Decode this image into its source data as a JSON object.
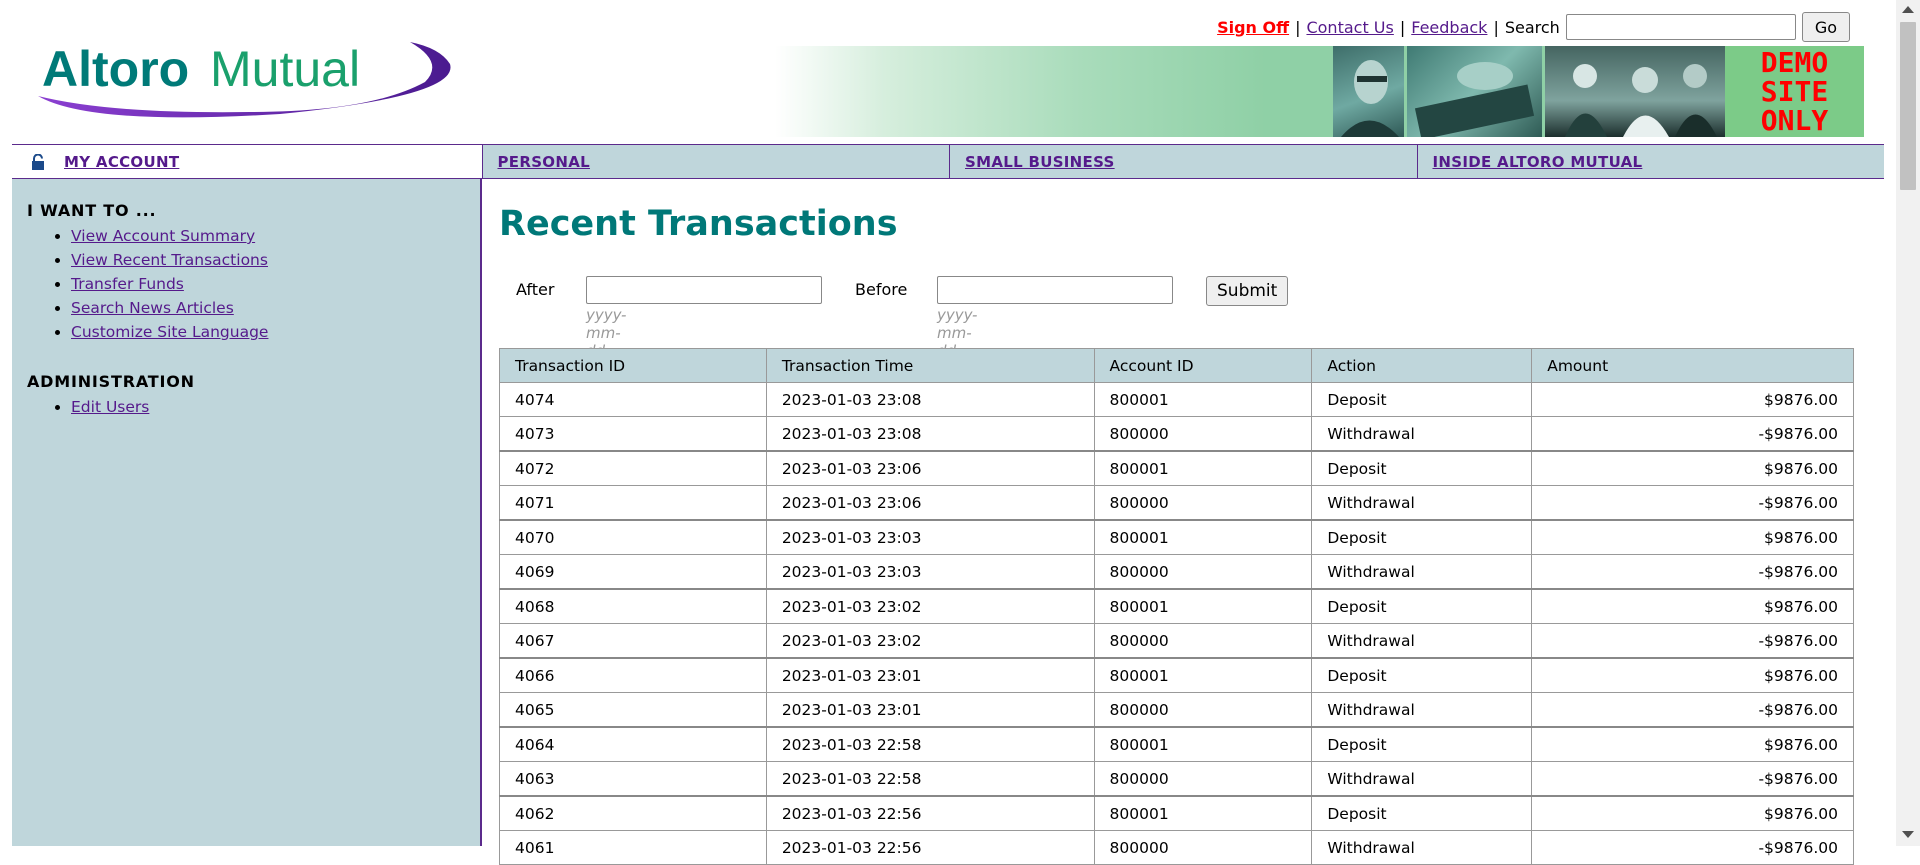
{
  "brand": {
    "logo_part1": "Altoro",
    "logo_part2": "Mutual",
    "banner_text": "DEMO SITE ONLY"
  },
  "colors": {
    "teal": "#007878",
    "purple": "#5b2a8c",
    "panel": "#bfd6db",
    "link": "#551a8b",
    "signoff": "#ff0000"
  },
  "top_links": {
    "sign_off": "Sign Off",
    "sep": "|",
    "contact": "Contact Us",
    "feedback": "Feedback",
    "search_label": "Search",
    "search_value": "",
    "go": "Go"
  },
  "nav": {
    "items": [
      "MY ACCOUNT",
      "PERSONAL",
      "SMALL BUSINESS",
      "INSIDE ALTORO MUTUAL"
    ]
  },
  "sidebar": {
    "heading1": "I WANT TO ...",
    "links": [
      "View Account Summary",
      "View Recent Transactions",
      "Transfer Funds",
      "Search News Articles",
      "Customize Site Language"
    ],
    "heading2": "ADMINISTRATION",
    "admin_links": [
      "Edit Users"
    ]
  },
  "main": {
    "title": "Recent Transactions",
    "filter": {
      "after_label": "After",
      "before_label": "Before",
      "hint": "yyyy-mm-dd",
      "after_value": "",
      "before_value": "",
      "submit": "Submit"
    },
    "columns": [
      "Transaction ID",
      "Transaction Time",
      "Account ID",
      "Action",
      "Amount"
    ],
    "rows": [
      [
        "4074",
        "2023-01-03 23:08",
        "800001",
        "Deposit",
        "$9876.00"
      ],
      [
        "4073",
        "2023-01-03 23:08",
        "800000",
        "Withdrawal",
        "-$9876.00"
      ],
      [
        "4072",
        "2023-01-03 23:06",
        "800001",
        "Deposit",
        "$9876.00"
      ],
      [
        "4071",
        "2023-01-03 23:06",
        "800000",
        "Withdrawal",
        "-$9876.00"
      ],
      [
        "4070",
        "2023-01-03 23:03",
        "800001",
        "Deposit",
        "$9876.00"
      ],
      [
        "4069",
        "2023-01-03 23:03",
        "800000",
        "Withdrawal",
        "-$9876.00"
      ],
      [
        "4068",
        "2023-01-03 23:02",
        "800001",
        "Deposit",
        "$9876.00"
      ],
      [
        "4067",
        "2023-01-03 23:02",
        "800000",
        "Withdrawal",
        "-$9876.00"
      ],
      [
        "4066",
        "2023-01-03 23:01",
        "800001",
        "Deposit",
        "$9876.00"
      ],
      [
        "4065",
        "2023-01-03 23:01",
        "800000",
        "Withdrawal",
        "-$9876.00"
      ],
      [
        "4064",
        "2023-01-03 22:58",
        "800001",
        "Deposit",
        "$9876.00"
      ],
      [
        "4063",
        "2023-01-03 22:58",
        "800000",
        "Withdrawal",
        "-$9876.00"
      ],
      [
        "4062",
        "2023-01-03 22:56",
        "800001",
        "Deposit",
        "$9876.00"
      ],
      [
        "4061",
        "2023-01-03 22:56",
        "800000",
        "Withdrawal",
        "-$9876.00"
      ]
    ]
  },
  "icons": {
    "lock": "lock-icon"
  }
}
